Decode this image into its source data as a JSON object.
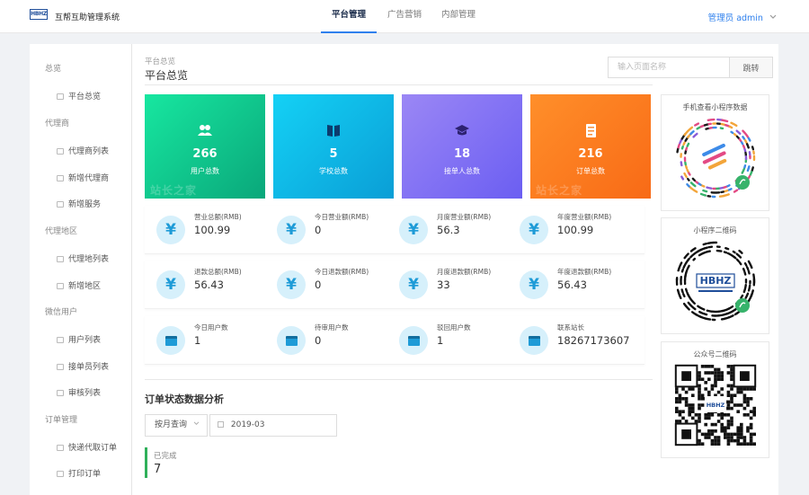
{
  "header": {
    "logo_text": "HBHZ",
    "app_title": "互帮互助管理系统",
    "tabs": [
      {
        "label": "平台管理",
        "active": true
      },
      {
        "label": "广告营销",
        "active": false
      },
      {
        "label": "内部管理",
        "active": false
      }
    ],
    "user_label": "管理员 admin",
    "user_chevron": "chevron-down-icon"
  },
  "sidebar": {
    "items": [
      {
        "type": "group",
        "label": "总览"
      },
      {
        "type": "item",
        "label": "平台总览",
        "icon": "grid-icon"
      },
      {
        "type": "group",
        "label": "代理商"
      },
      {
        "type": "item",
        "label": "代理商列表",
        "icon": "calendar-icon"
      },
      {
        "type": "item",
        "label": "新增代理商",
        "icon": "edit-icon"
      },
      {
        "type": "item",
        "label": "新增服务",
        "icon": "edit-icon"
      },
      {
        "type": "group",
        "label": "代理地区"
      },
      {
        "type": "item",
        "label": "代理地列表",
        "icon": "calendar-icon"
      },
      {
        "type": "item",
        "label": "新增地区",
        "icon": "edit-icon"
      },
      {
        "type": "group",
        "label": "微信用户"
      },
      {
        "type": "item",
        "label": "用户列表",
        "icon": "users-icon"
      },
      {
        "type": "item",
        "label": "接单员列表",
        "icon": "list-icon"
      },
      {
        "type": "item",
        "label": "审核列表",
        "icon": "list-icon"
      },
      {
        "type": "group",
        "label": "订单管理"
      },
      {
        "type": "item",
        "label": "快递代取订单",
        "icon": "package-icon"
      },
      {
        "type": "item",
        "label": "打印订单",
        "icon": "print-icon"
      }
    ]
  },
  "page": {
    "breadcrumb": "平台总览",
    "title": "平台总览",
    "search_placeholder": "输入页面名称",
    "jump_label": "跳转"
  },
  "tiles": [
    {
      "value": "266",
      "label": "用户总数",
      "icon": "users-icon",
      "color_from": "#17e7a0",
      "color_to": "#0aa77a"
    },
    {
      "value": "5",
      "label": "学校总数",
      "icon": "book-icon",
      "color_from": "#14d1f5",
      "color_to": "#0a9ed6"
    },
    {
      "value": "18",
      "label": "接单人总数",
      "icon": "graduation-cap-icon",
      "color_from": "#9b87f5",
      "color_to": "#6b5ef2"
    },
    {
      "value": "216",
      "label": "订单总数",
      "icon": "document-icon",
      "color_from": "#ff8f2a",
      "color_to": "#f86a16"
    }
  ],
  "watermark_text": "站长之家",
  "metrics": [
    [
      {
        "label": "营业总额(RMB)",
        "value": "100.99",
        "icon": "yen-icon"
      },
      {
        "label": "今日营业额(RMB)",
        "value": "0",
        "icon": "yen-icon"
      },
      {
        "label": "月度营业额(RMB)",
        "value": "56.3",
        "icon": "yen-icon"
      },
      {
        "label": "年度营业额(RMB)",
        "value": "100.99",
        "icon": "yen-icon"
      }
    ],
    [
      {
        "label": "退款总额(RMB)",
        "value": "56.43",
        "icon": "yen-icon"
      },
      {
        "label": "今日退款额(RMB)",
        "value": "0",
        "icon": "yen-icon"
      },
      {
        "label": "月度退款额(RMB)",
        "value": "33",
        "icon": "yen-icon"
      },
      {
        "label": "年度退款额(RMB)",
        "value": "56.43",
        "icon": "yen-icon"
      }
    ],
    [
      {
        "label": "今日用户数",
        "value": "1",
        "icon": "calendar-icon"
      },
      {
        "label": "待审用户数",
        "value": "0",
        "icon": "calendar-icon"
      },
      {
        "label": "驳回用户数",
        "value": "1",
        "icon": "calendar-icon"
      },
      {
        "label": "联系站长",
        "value": "18267173607",
        "icon": "calendar-icon"
      }
    ]
  ],
  "yen_glyph": "¥",
  "analysis": {
    "title": "订单状态数据分析",
    "query_mode": "按月查询",
    "date_value": "2019-03",
    "status_label": "已完成",
    "status_value": "7",
    "status_color": "#2fb05a"
  },
  "qr_panels": [
    {
      "title": "手机查看小程序数据",
      "kind": "mini-program"
    },
    {
      "title": "小程序二维码",
      "kind": "mini-program-hbhz",
      "center_text": "HBHZ"
    },
    {
      "title": "公众号二维码",
      "kind": "square-qr",
      "center_text": "HBHZ"
    }
  ]
}
